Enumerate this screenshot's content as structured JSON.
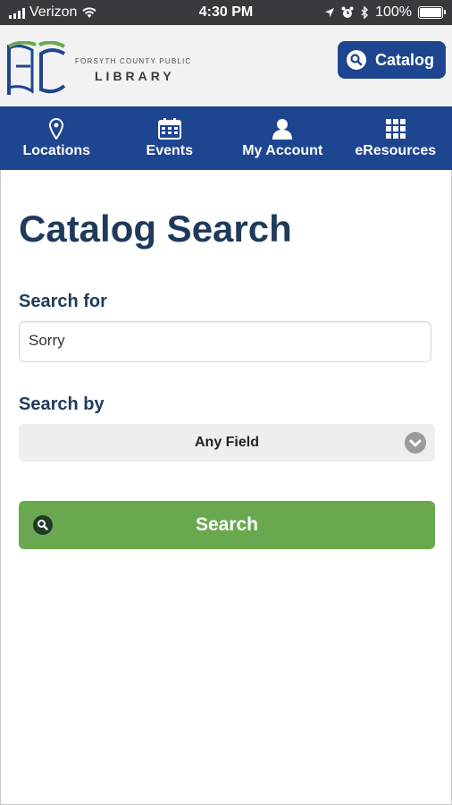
{
  "status_bar": {
    "carrier": "Verizon",
    "time": "4:30 PM",
    "battery": "100%",
    "icons": [
      "signal-icon",
      "wifi-icon",
      "location-arrow-icon",
      "alarm-icon",
      "bluetooth-icon",
      "battery-icon"
    ]
  },
  "header": {
    "library_name_line1": "FORSYTH COUNTY PUBLIC",
    "library_name_line2": "LIBRARY",
    "catalog_button": "Catalog",
    "colors": {
      "brand_blue": "#1e4590",
      "logo_blue": "#1e4590",
      "logo_green": "#6aa84f"
    }
  },
  "nav": {
    "items": [
      {
        "label": "Locations",
        "icon": "map-pin-icon"
      },
      {
        "label": "Events",
        "icon": "calendar-icon"
      },
      {
        "label": "My Account",
        "icon": "user-icon"
      },
      {
        "label": "eResources",
        "icon": "grid-icon"
      }
    ]
  },
  "main": {
    "title": "Catalog Search",
    "search_for_label": "Search for",
    "search_value": "Sorry",
    "search_by_label": "Search by",
    "search_by_selected": "Any Field",
    "search_button": "Search",
    "colors": {
      "heading": "#1f3a5c",
      "button_green": "#6aa84f"
    }
  }
}
